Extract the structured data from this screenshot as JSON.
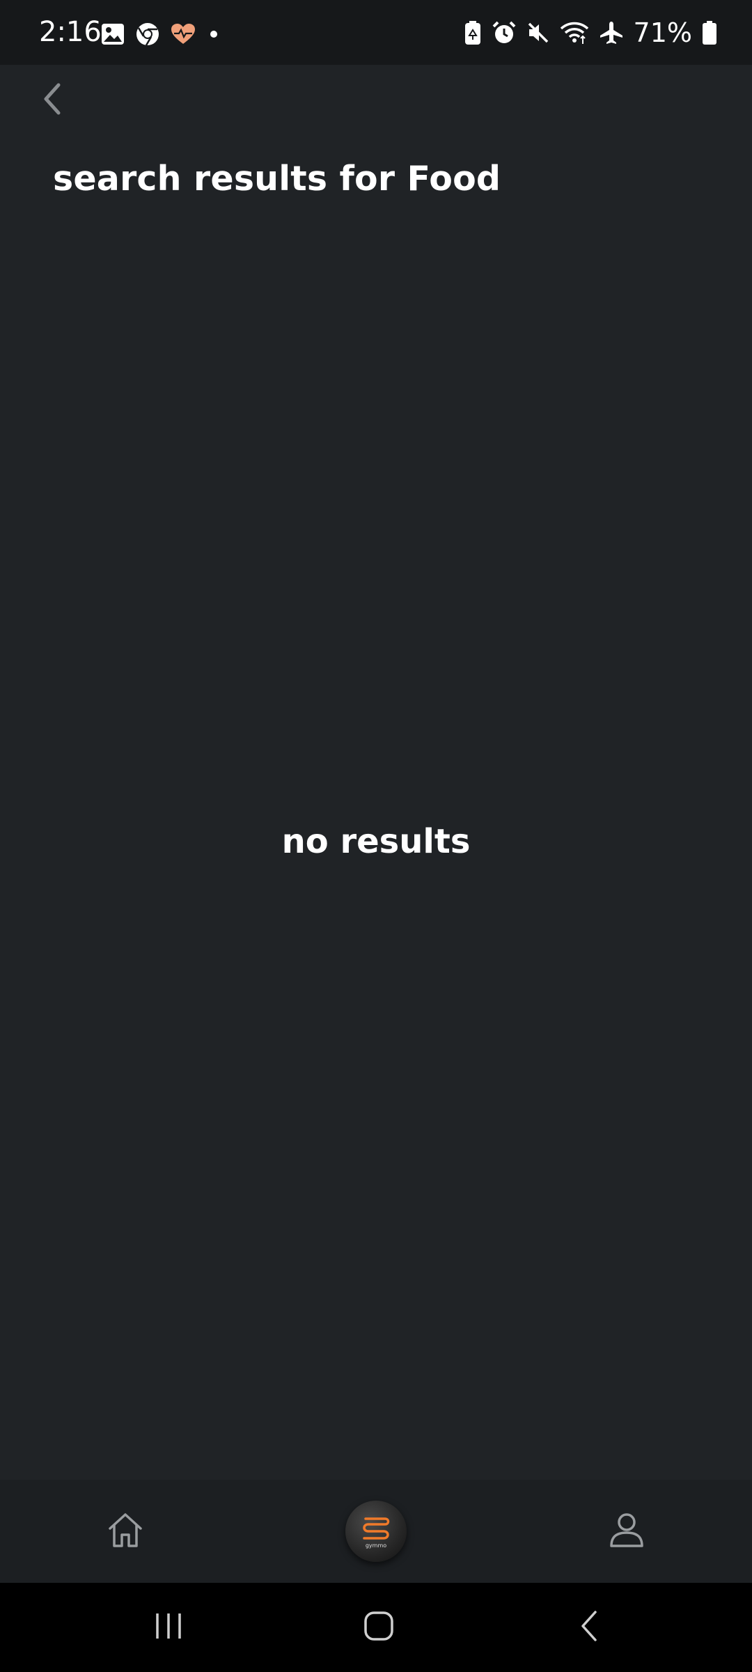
{
  "status_bar": {
    "time": "2:16",
    "battery_percent": "71%",
    "left_icons": [
      "gallery-icon",
      "chrome-icon",
      "health-icon",
      "dot-icon"
    ],
    "right_icons": [
      "battery-saver-icon",
      "alarm-icon",
      "mute-icon",
      "wifi-icon",
      "airplane-icon",
      "battery-icon"
    ]
  },
  "header": {
    "back_icon": "chevron-left-icon",
    "title": "search results for Food"
  },
  "main": {
    "empty_message": "no results"
  },
  "bottom_nav": {
    "items": [
      {
        "icon": "home-icon"
      },
      {
        "icon": "app-logo-icon",
        "logo_text": "gymmo"
      },
      {
        "icon": "profile-icon"
      }
    ]
  },
  "system_nav": {
    "buttons": [
      "recents-icon",
      "home-circle-icon",
      "back-icon"
    ]
  },
  "colors": {
    "background": "#202326",
    "status_bar": "#16181a",
    "bottom_nav": "#1c1f22",
    "text": "#ffffff",
    "accent": "#f07a2a"
  }
}
